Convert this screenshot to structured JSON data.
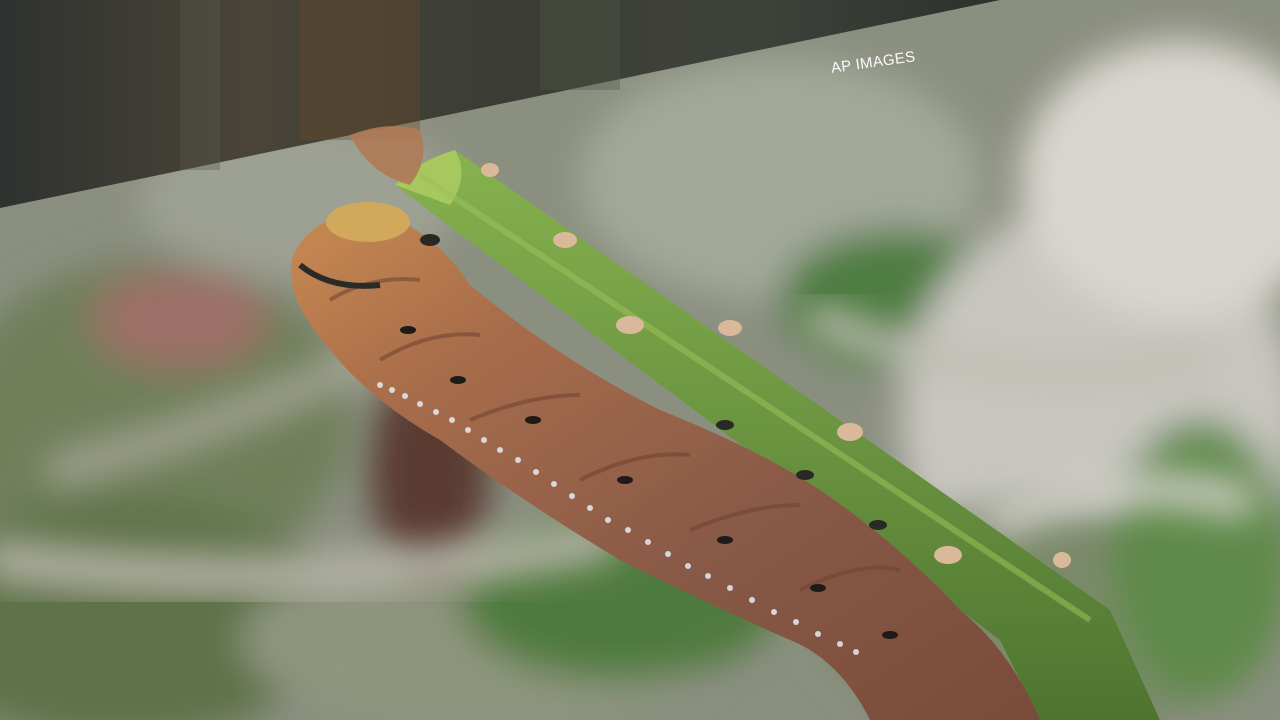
{
  "watermark": {
    "text": "AP IMAGES"
  },
  "colors": {
    "stem": "#6f9a3e",
    "caterpillar_body": "#8c5a45",
    "caterpillar_head": "#c9894e",
    "background_blur": "#8a8f7e",
    "dark_band": "#3a3a36"
  }
}
